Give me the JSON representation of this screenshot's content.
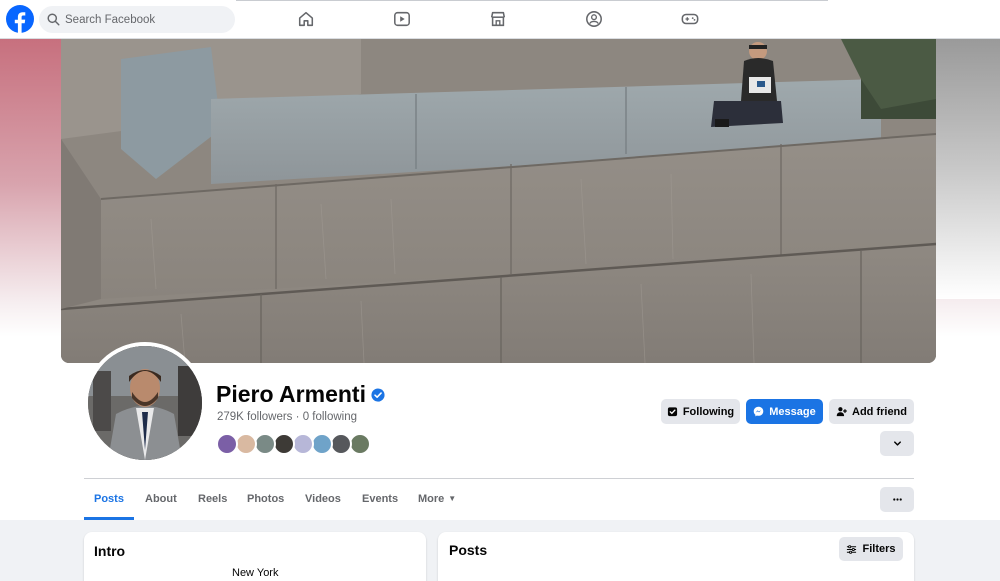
{
  "search": {
    "placeholder": "Search Facebook"
  },
  "nav": {
    "icons": [
      "home-icon",
      "video-icon",
      "marketplace-icon",
      "groups-icon",
      "gaming-icon"
    ]
  },
  "profile": {
    "name": "Piero Armenti",
    "verified": true,
    "followers_text": "279K followers",
    "separator": "·",
    "following_text": "0 following",
    "friend_avatar_count": 8
  },
  "actions": {
    "following_label": "Following",
    "message_label": "Message",
    "add_friend_label": "Add friend"
  },
  "tabs": [
    {
      "label": "Posts",
      "active": true
    },
    {
      "label": "About",
      "active": false
    },
    {
      "label": "Reels",
      "active": false
    },
    {
      "label": "Photos",
      "active": false
    },
    {
      "label": "Videos",
      "active": false
    },
    {
      "label": "Events",
      "active": false
    },
    {
      "label": "More",
      "active": false
    }
  ],
  "intro": {
    "title": "Intro",
    "location": "New York"
  },
  "posts": {
    "title": "Posts",
    "filters_label": "Filters"
  },
  "colors": {
    "brand_blue": "#1b74e4",
    "button_gray": "#e4e6eb",
    "page_bg": "#f0f2f5",
    "secondary_text": "#65676b"
  }
}
